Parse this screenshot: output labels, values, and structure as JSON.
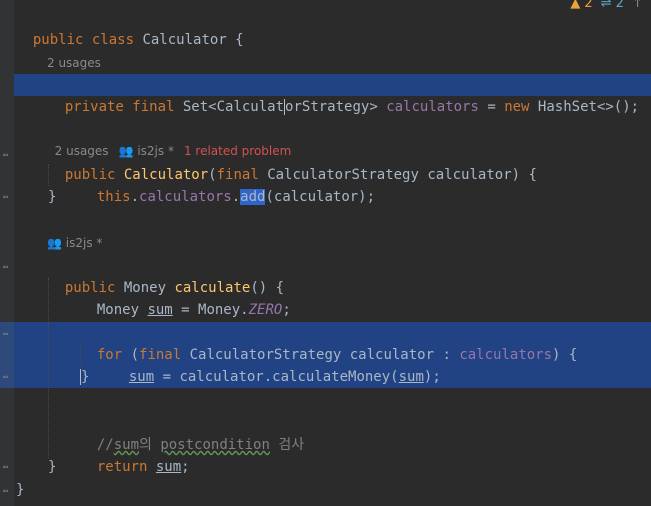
{
  "status": {
    "warnings": "2",
    "weak_warnings": "2"
  },
  "code": {
    "l1": {
      "a": "public class ",
      "b": "Calculator",
      "c": " {"
    },
    "inlay_calculators": "2 usages",
    "l2": {
      "a": "private final ",
      "b": "Set<Calculat",
      "c": "orStrategy> ",
      "d": "calculators",
      "e": " = ",
      "f": "new ",
      "g": "HashSet<>();"
    },
    "inlay_ctor": {
      "usages": "2 usages",
      "author": "is2js *",
      "problem": "1 related problem"
    },
    "l3": {
      "a": "public ",
      "b": "Calculator",
      "c": "(",
      "d": "final ",
      "e": "CalculatorStrategy calculator) {"
    },
    "l4": {
      "a": "this",
      "b": ".",
      "c": "calculators",
      "d": ".",
      "e": "add",
      "f": "(calculator);"
    },
    "l5": "}",
    "inlay_calc": "is2js *",
    "l6": {
      "a": "public ",
      "b": "Money ",
      "c": "calculate",
      "d": "() {"
    },
    "l7": {
      "a": "Money ",
      "b": "sum",
      "c": " = Money.",
      "d": "ZERO",
      "e": ";"
    },
    "l8": {
      "a": "for ",
      "b": "(",
      "c": "final ",
      "d": "CalculatorStrategy calculator : ",
      "e": "calculators",
      "f": ") {"
    },
    "l9": {
      "a": "sum",
      "b": " = calculator.calculateMoney(",
      "c": "sum",
      "d": ");"
    },
    "l10": "}",
    "l11": {
      "a": "//",
      "b": "sum",
      "c": "의 ",
      "d": "postcondition",
      "e": " 검사"
    },
    "l12": {
      "a": "return ",
      "b": "sum",
      "c": ";"
    },
    "l13": "}",
    "l14": "}"
  }
}
